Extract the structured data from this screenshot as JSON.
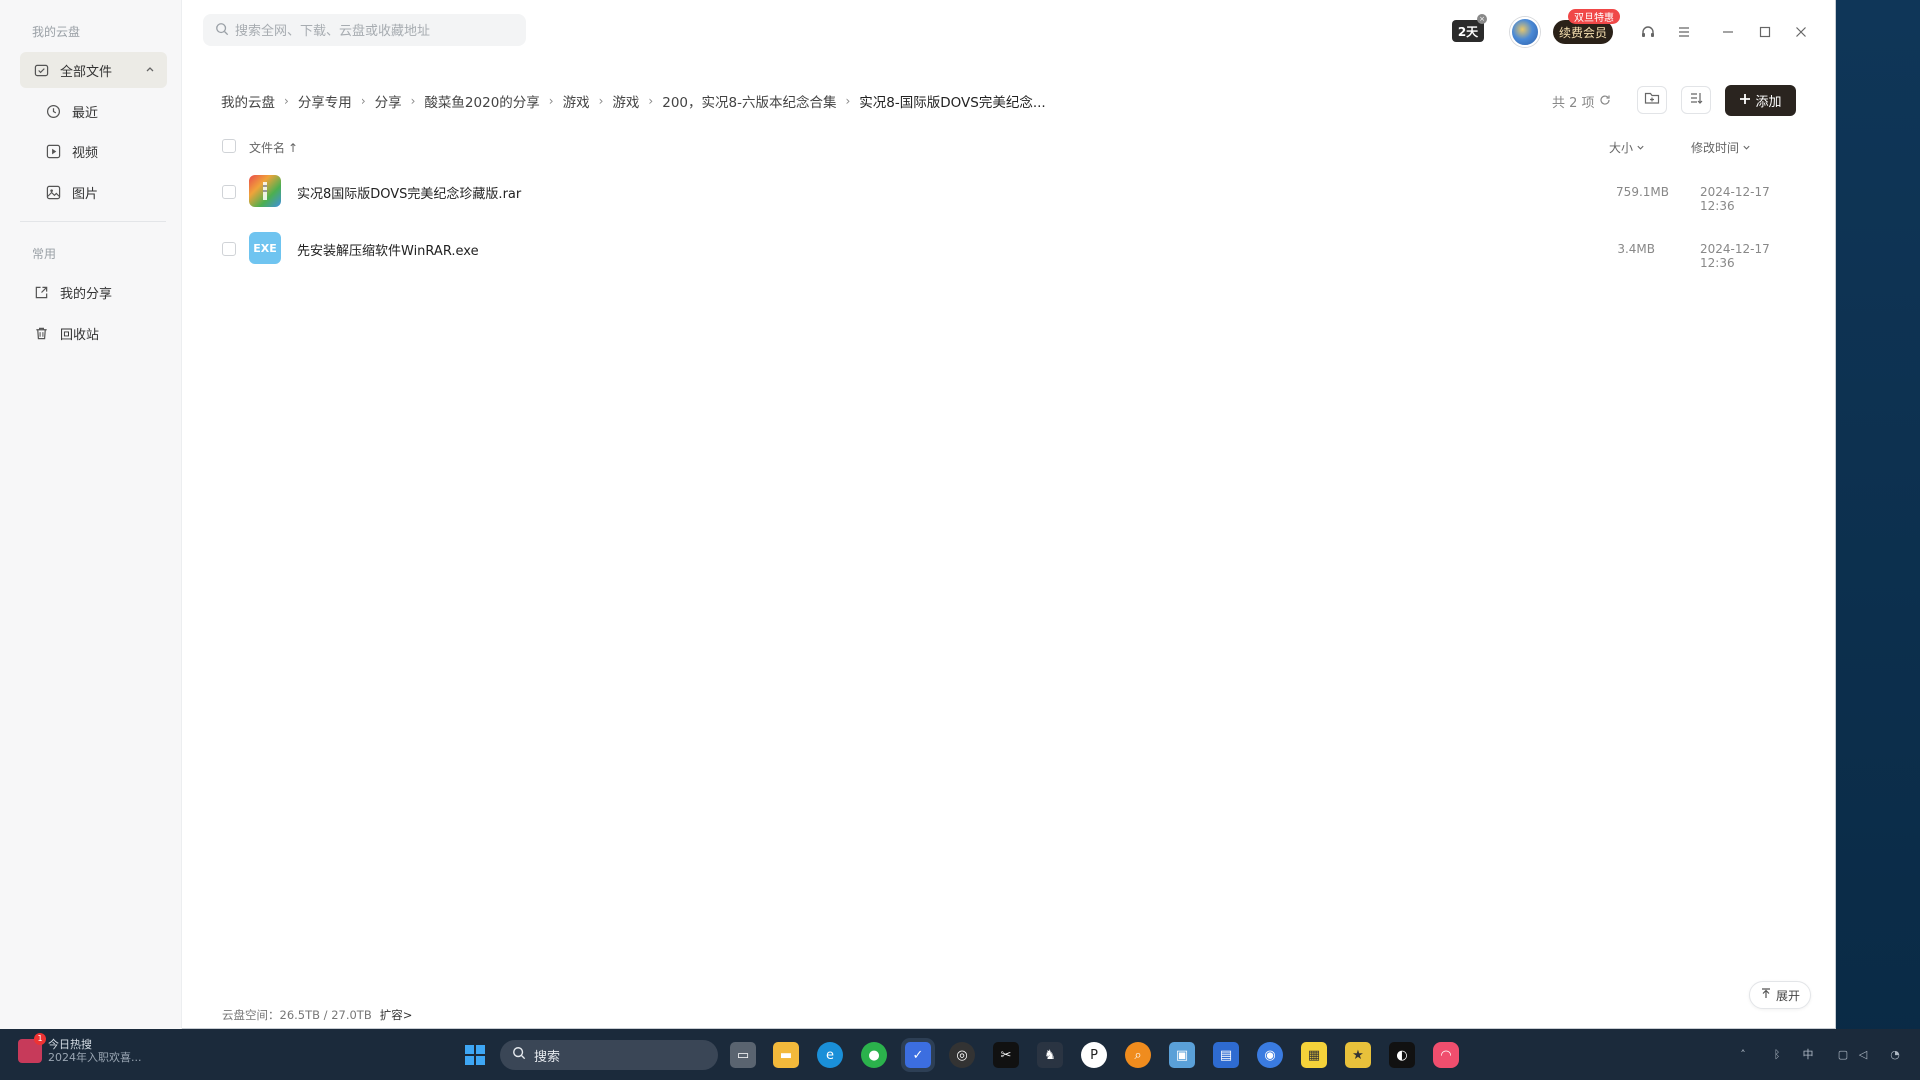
{
  "sidebar": {
    "section_title": "我的云盘",
    "all_files": "全部文件",
    "items": [
      {
        "label": "最近",
        "icon": "clock-icon"
      },
      {
        "label": "视频",
        "icon": "video-icon"
      },
      {
        "label": "图片",
        "icon": "image-icon"
      }
    ],
    "common_title": "常用",
    "common_items": [
      {
        "label": "我的分享",
        "icon": "share-icon"
      },
      {
        "label": "回收站",
        "icon": "trash-icon"
      }
    ]
  },
  "search": {
    "placeholder": "搜索全网、下载、云盘或收藏地址"
  },
  "header": {
    "trial_days": "2天",
    "vip_button": "续费会员",
    "vip_tag": "双旦特惠"
  },
  "breadcrumb": [
    "我的云盘",
    "分享专用",
    "分享",
    "酸菜鱼2020的分享",
    "游戏",
    "游戏",
    "200，实况8-六版本纪念合集",
    "实况8-国际版DOVS完美纪念..."
  ],
  "toolbar": {
    "count": "共 2 项",
    "add_label": "添加"
  },
  "table": {
    "col_name": "文件名",
    "col_size": "大小",
    "col_date": "修改时间",
    "rows": [
      {
        "name": "实况8国际版DOVS完美纪念珍藏版.rar",
        "size": "759.1MB",
        "date": "2024-12-17 12:36",
        "type": "rar"
      },
      {
        "name": "先安装解压缩软件WinRAR.exe",
        "size": "3.4MB",
        "date": "2024-12-17 12:36",
        "type": "EXE"
      }
    ]
  },
  "footer": {
    "storage": "云盘空间：26.5TB / 27.0TB",
    "expand_storage": "扩容>",
    "expand_panel": "展开"
  },
  "taskbar": {
    "news_title": "今日热搜",
    "news_sub": "2024年入职欢喜...",
    "news_count": "1",
    "search_label": "搜索"
  }
}
